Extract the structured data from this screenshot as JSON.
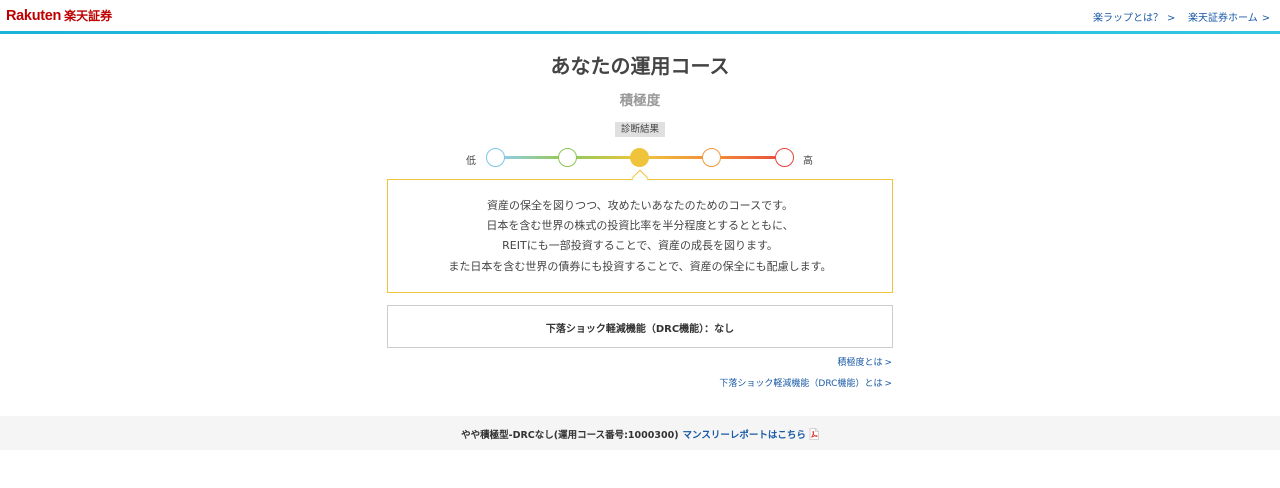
{
  "header": {
    "logo_en": "Rakuten",
    "logo_ja": "楽天証券",
    "links": [
      {
        "label": "楽ラップとは？"
      },
      {
        "label": "楽天証券ホーム"
      }
    ],
    "accent_color": "#1ab3d8"
  },
  "main": {
    "title": "あなたの運用コース",
    "subtitle": "積極度",
    "scale": {
      "badge": "診断結果",
      "low_label": "低",
      "high_label": "高",
      "level": 3,
      "levels_total": 5,
      "colors": [
        "#7ec6e6",
        "#8dc554",
        "#f0c43a",
        "#f09a3c",
        "#e8463c"
      ]
    },
    "description": [
      "資産の保全を図りつつ、攻めたいあなたのためのコースです。",
      "日本を含む世界の株式の投資比率を半分程度とするとともに、",
      "REITにも一部投資することで、資産の成長を図ります。",
      "また日本を含む世界の債券にも投資することで、資産の保全にも配慮します。"
    ],
    "drc_text": "下落ショック軽減機能（DRC機能）：なし",
    "links": {
      "aggressiveness": "積極度とは",
      "drc": "下落ショック軽減機能（DRC機能）とは"
    }
  },
  "footer": {
    "course_name": "やや積極型-DRCなし(運用コース番号:1000300)",
    "monthly_report_link": "マンスリーレポートはこちら",
    "pdf_icon": "pdf-icon"
  }
}
